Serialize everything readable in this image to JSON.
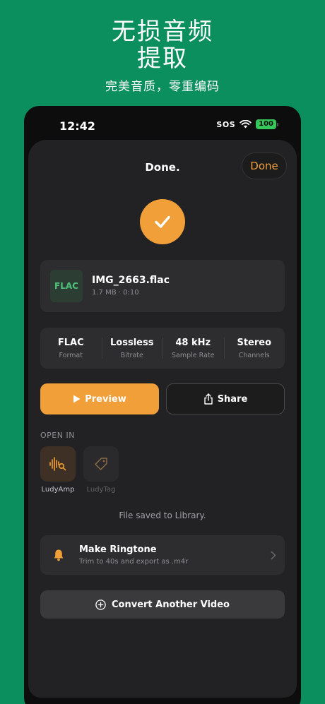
{
  "promo": {
    "title_line1": "无损音频",
    "title_line2": "提取",
    "subtitle": "完美音质，零重编码"
  },
  "status_bar": {
    "time": "12:42",
    "sos": "SOS",
    "battery": "100"
  },
  "header": {
    "title": "Done.",
    "done_button": "Done"
  },
  "file": {
    "format_badge": "FLAC",
    "name": "IMG_2663.flac",
    "meta": "1.7 MB · 0:10"
  },
  "specs": [
    {
      "value": "FLAC",
      "label": "Format"
    },
    {
      "value": "Lossless",
      "label": "Bitrate"
    },
    {
      "value": "48 kHz",
      "label": "Sample Rate"
    },
    {
      "value": "Stereo",
      "label": "Channels"
    }
  ],
  "actions": {
    "preview": "Preview",
    "share": "Share"
  },
  "open_in": {
    "label": "OPEN IN",
    "apps": [
      {
        "name": "LudyAmp",
        "icon": "waveform-search-icon",
        "enabled": true
      },
      {
        "name": "LudyTag",
        "icon": "tag-icon",
        "enabled": false
      }
    ]
  },
  "saved_note": "File saved to Library.",
  "ringtone": {
    "title": "Make Ringtone",
    "subtitle": "Trim to 40s and export as .m4r"
  },
  "convert_button": "Convert Another Video",
  "colors": {
    "background": "#0b8f5e",
    "accent": "#f19f38",
    "sheet": "#222224",
    "card": "#2d2d2f",
    "flac_green": "#4ec27a"
  }
}
